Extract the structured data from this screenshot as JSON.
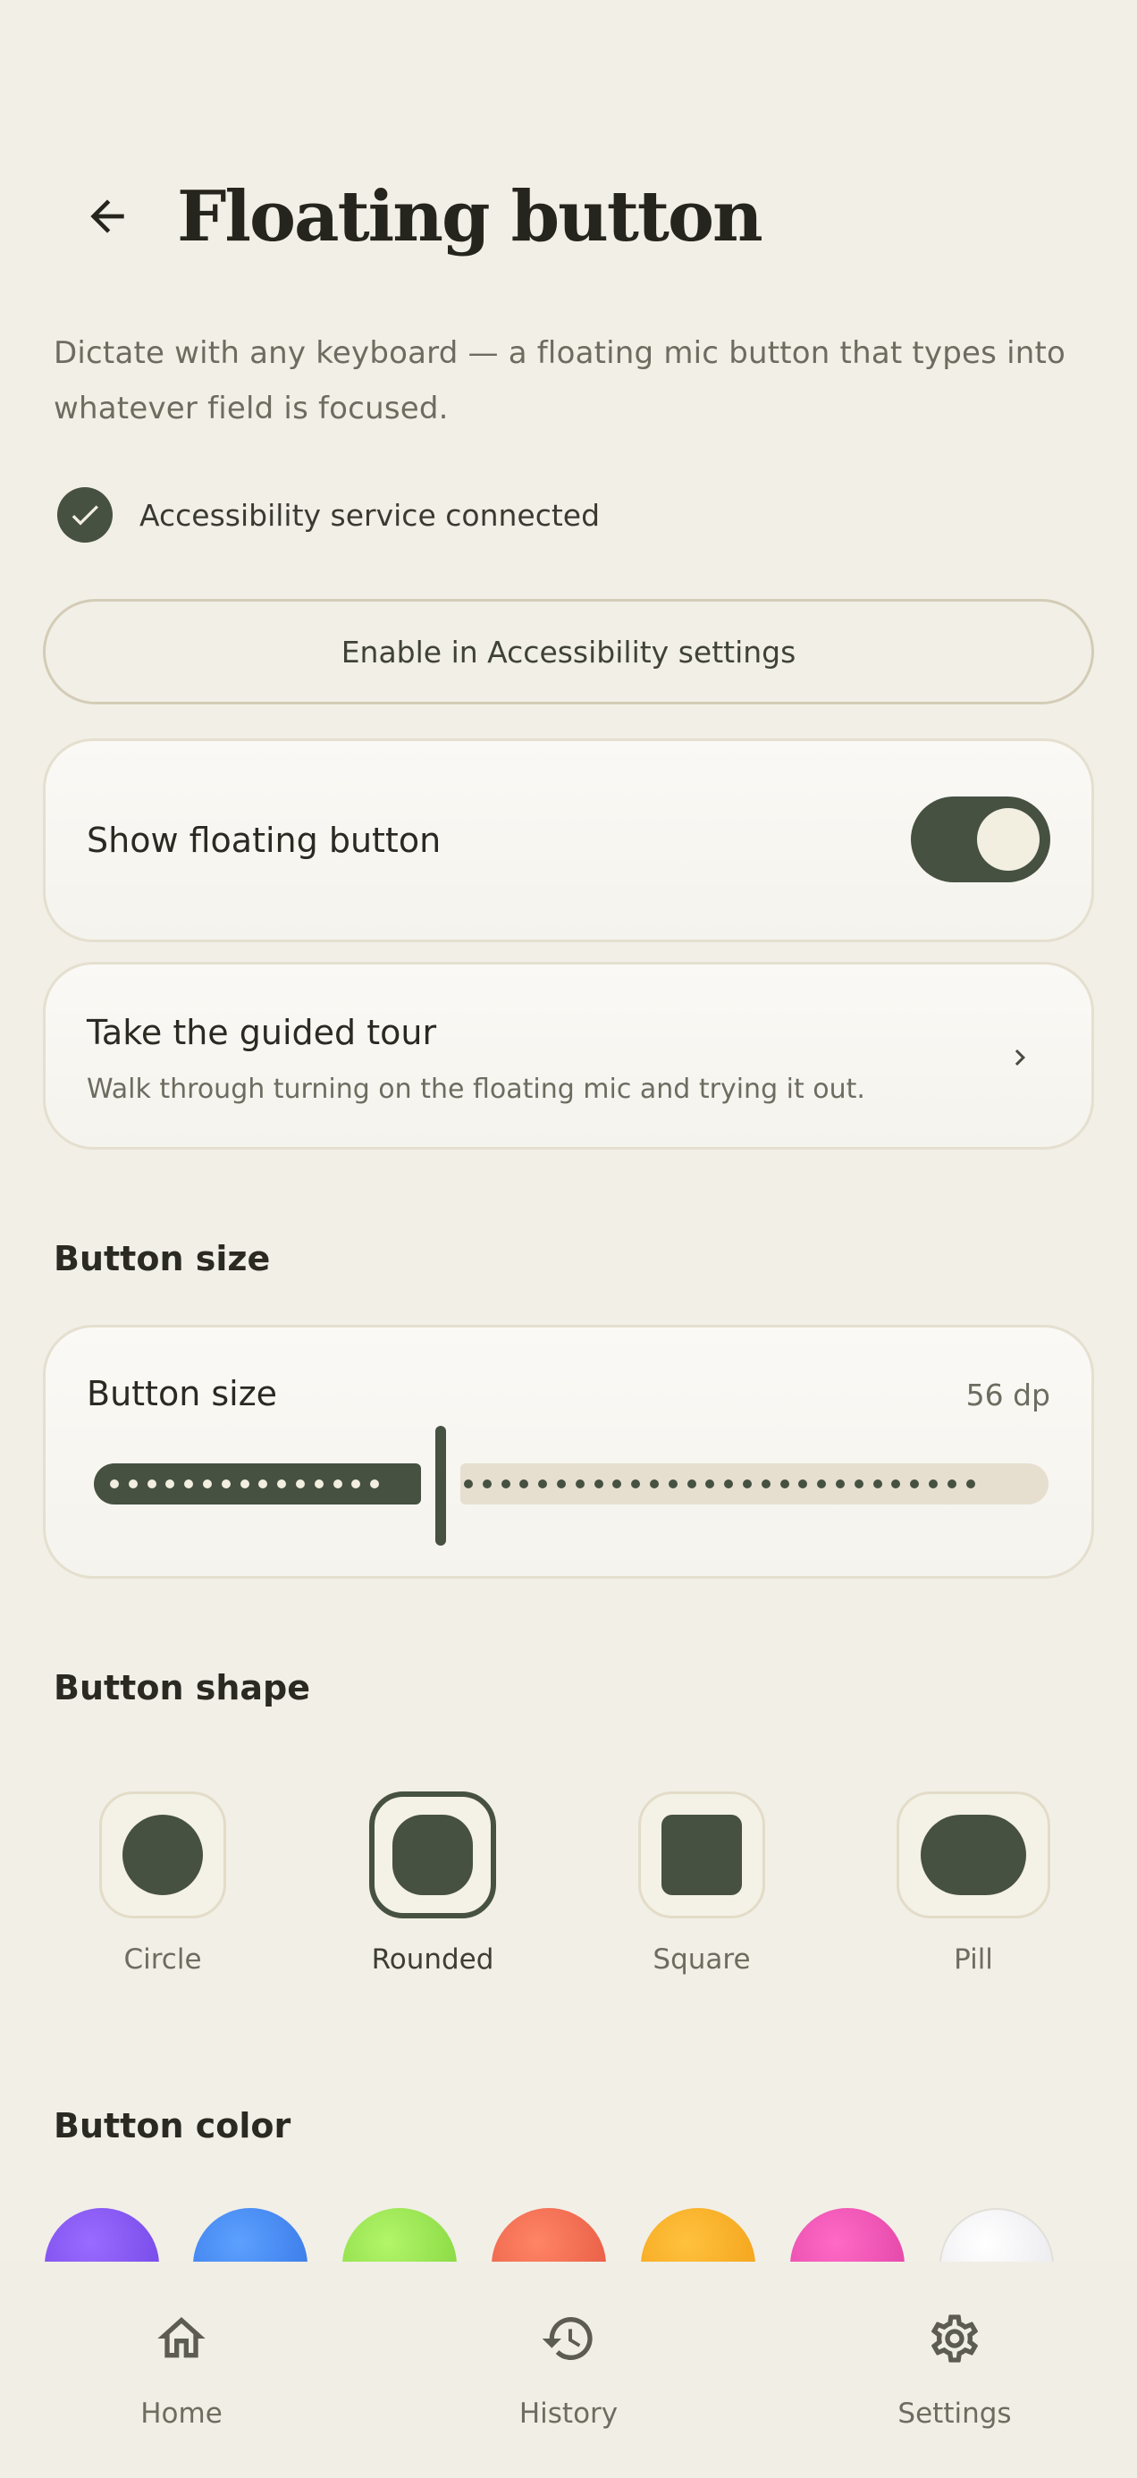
{
  "header": {
    "title": "Floating button"
  },
  "description": "Dictate with any keyboard — a floating mic button that types into whatever field is focused.",
  "status": {
    "text": "Accessibility service connected"
  },
  "enable_button": {
    "label": "Enable in Accessibility settings"
  },
  "show_floating": {
    "label": "Show floating button",
    "enabled": true
  },
  "tour": {
    "title": "Take the guided tour",
    "subtitle": "Walk through turning on the floating mic and trying it out."
  },
  "size_section": {
    "title": "Button size",
    "label": "Button size",
    "value": "56 dp"
  },
  "shape_section": {
    "title": "Button shape",
    "options": [
      {
        "label": "Circle",
        "selected": false
      },
      {
        "label": "Rounded",
        "selected": true
      },
      {
        "label": "Square",
        "selected": false
      },
      {
        "label": "Pill",
        "selected": false
      }
    ]
  },
  "color_section": {
    "title": "Button color",
    "swatches": [
      "#7B4DF0",
      "#3F86F0",
      "#8FE24A",
      "#F0644A",
      "#F7A91E",
      "#E84BB0",
      "#F5F5F7"
    ]
  },
  "colors": {
    "accent": "#465141",
    "background": "#F2EFE7"
  },
  "bottom_nav": {
    "items": [
      {
        "label": "Home",
        "icon": "home-icon"
      },
      {
        "label": "History",
        "icon": "history-icon"
      },
      {
        "label": "Settings",
        "icon": "gear-icon"
      }
    ]
  }
}
